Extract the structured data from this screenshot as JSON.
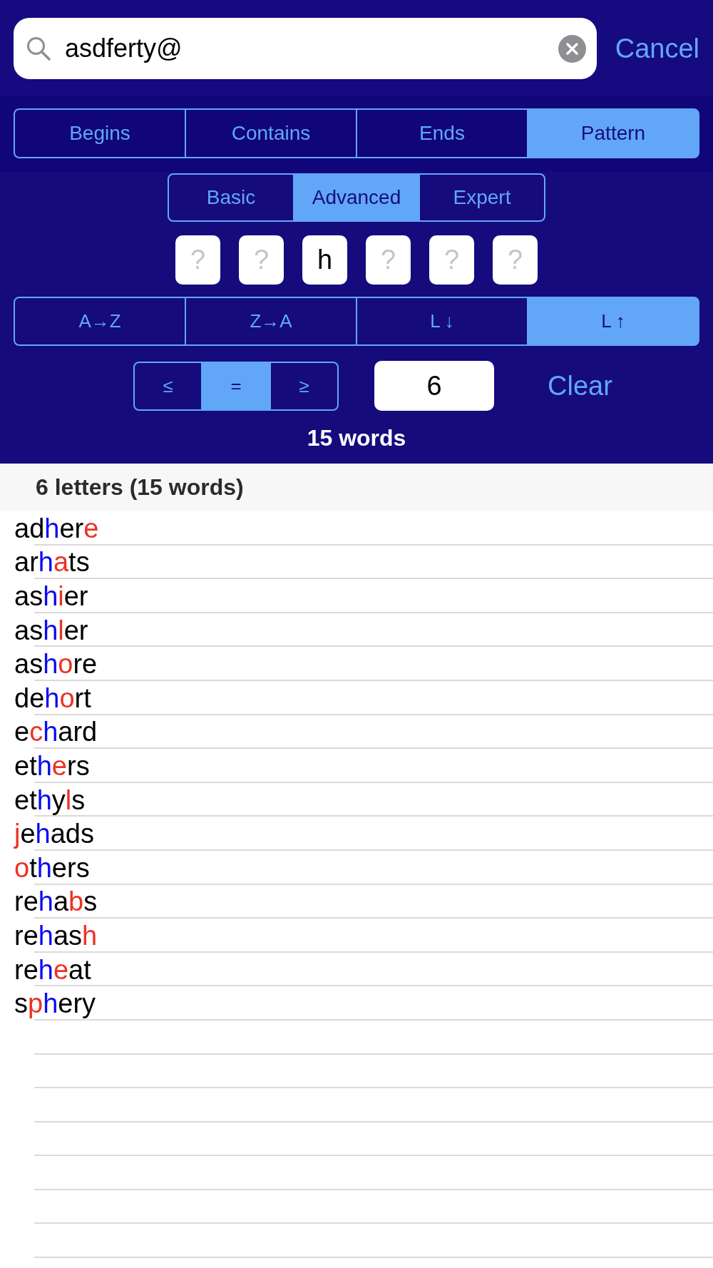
{
  "search": {
    "value": "asdferty@",
    "cancel": "Cancel"
  },
  "match_modes": [
    {
      "label": "Begins",
      "selected": false
    },
    {
      "label": "Contains",
      "selected": false
    },
    {
      "label": "Ends",
      "selected": false
    },
    {
      "label": "Pattern",
      "selected": true
    }
  ],
  "levels": [
    {
      "label": "Basic",
      "selected": false
    },
    {
      "label": "Advanced",
      "selected": true
    },
    {
      "label": "Expert",
      "selected": false
    }
  ],
  "pattern_slots": [
    {
      "placeholder": "?"
    },
    {
      "placeholder": "?"
    },
    {
      "value": "h"
    },
    {
      "placeholder": "?"
    },
    {
      "placeholder": "?"
    },
    {
      "placeholder": "?"
    }
  ],
  "sort_options": [
    {
      "label": "A→Z",
      "selected": false
    },
    {
      "label": "Z→A",
      "selected": false
    },
    {
      "label": "L ↓",
      "selected": false
    },
    {
      "label": "L ↑",
      "selected": true
    }
  ],
  "length_filter": {
    "comparisons": [
      {
        "label": "≤",
        "selected": false
      },
      {
        "label": "=",
        "selected": true
      },
      {
        "label": "≥",
        "selected": false
      }
    ],
    "length": {
      "value": "6"
    },
    "clear": "Clear"
  },
  "word_count": "15 words",
  "results": {
    "section_title": "6 letters (15 words)",
    "words": [
      {
        "parts": [
          {
            "text": "ad",
            "kind": "plain"
          },
          {
            "text": "h",
            "kind": "pattern"
          },
          {
            "text": "er",
            "kind": "plain"
          },
          {
            "text": "e",
            "kind": "wildcard"
          }
        ]
      },
      {
        "parts": [
          {
            "text": "ar",
            "kind": "plain"
          },
          {
            "text": "h",
            "kind": "pattern"
          },
          {
            "text": "a",
            "kind": "wildcard"
          },
          {
            "text": "ts",
            "kind": "plain"
          }
        ]
      },
      {
        "parts": [
          {
            "text": "as",
            "kind": "plain"
          },
          {
            "text": "h",
            "kind": "pattern"
          },
          {
            "text": "i",
            "kind": "wildcard"
          },
          {
            "text": "er",
            "kind": "plain"
          }
        ]
      },
      {
        "parts": [
          {
            "text": "as",
            "kind": "plain"
          },
          {
            "text": "h",
            "kind": "pattern"
          },
          {
            "text": "l",
            "kind": "wildcard"
          },
          {
            "text": "er",
            "kind": "plain"
          }
        ]
      },
      {
        "parts": [
          {
            "text": "as",
            "kind": "plain"
          },
          {
            "text": "h",
            "kind": "pattern"
          },
          {
            "text": "o",
            "kind": "wildcard"
          },
          {
            "text": "re",
            "kind": "plain"
          }
        ]
      },
      {
        "parts": [
          {
            "text": "de",
            "kind": "plain"
          },
          {
            "text": "h",
            "kind": "pattern"
          },
          {
            "text": "o",
            "kind": "wildcard"
          },
          {
            "text": "rt",
            "kind": "plain"
          }
        ]
      },
      {
        "parts": [
          {
            "text": "e",
            "kind": "plain"
          },
          {
            "text": "c",
            "kind": "wildcard"
          },
          {
            "text": "h",
            "kind": "pattern"
          },
          {
            "text": "ard",
            "kind": "plain"
          }
        ]
      },
      {
        "parts": [
          {
            "text": "et",
            "kind": "plain"
          },
          {
            "text": "h",
            "kind": "pattern"
          },
          {
            "text": "e",
            "kind": "wildcard"
          },
          {
            "text": "rs",
            "kind": "plain"
          }
        ]
      },
      {
        "parts": [
          {
            "text": "et",
            "kind": "plain"
          },
          {
            "text": "h",
            "kind": "pattern"
          },
          {
            "text": "y",
            "kind": "plain"
          },
          {
            "text": "l",
            "kind": "wildcard"
          },
          {
            "text": "s",
            "kind": "plain"
          }
        ]
      },
      {
        "parts": [
          {
            "text": "j",
            "kind": "wildcard"
          },
          {
            "text": "e",
            "kind": "plain"
          },
          {
            "text": "h",
            "kind": "pattern"
          },
          {
            "text": "ads",
            "kind": "plain"
          }
        ]
      },
      {
        "parts": [
          {
            "text": "o",
            "kind": "wildcard"
          },
          {
            "text": "t",
            "kind": "plain"
          },
          {
            "text": "h",
            "kind": "pattern"
          },
          {
            "text": "ers",
            "kind": "plain"
          }
        ]
      },
      {
        "parts": [
          {
            "text": "re",
            "kind": "plain"
          },
          {
            "text": "h",
            "kind": "pattern"
          },
          {
            "text": "a",
            "kind": "plain"
          },
          {
            "text": "b",
            "kind": "wildcard"
          },
          {
            "text": "s",
            "kind": "plain"
          }
        ]
      },
      {
        "parts": [
          {
            "text": "re",
            "kind": "plain"
          },
          {
            "text": "h",
            "kind": "pattern"
          },
          {
            "text": "as",
            "kind": "plain"
          },
          {
            "text": "h",
            "kind": "wildcard"
          }
        ]
      },
      {
        "parts": [
          {
            "text": "re",
            "kind": "plain"
          },
          {
            "text": "h",
            "kind": "pattern"
          },
          {
            "text": "e",
            "kind": "wildcard"
          },
          {
            "text": "at",
            "kind": "plain"
          }
        ]
      },
      {
        "parts": [
          {
            "text": "s",
            "kind": "plain"
          },
          {
            "text": "p",
            "kind": "wildcard"
          },
          {
            "text": "h",
            "kind": "pattern"
          },
          {
            "text": "ery",
            "kind": "plain"
          }
        ]
      }
    ]
  }
}
